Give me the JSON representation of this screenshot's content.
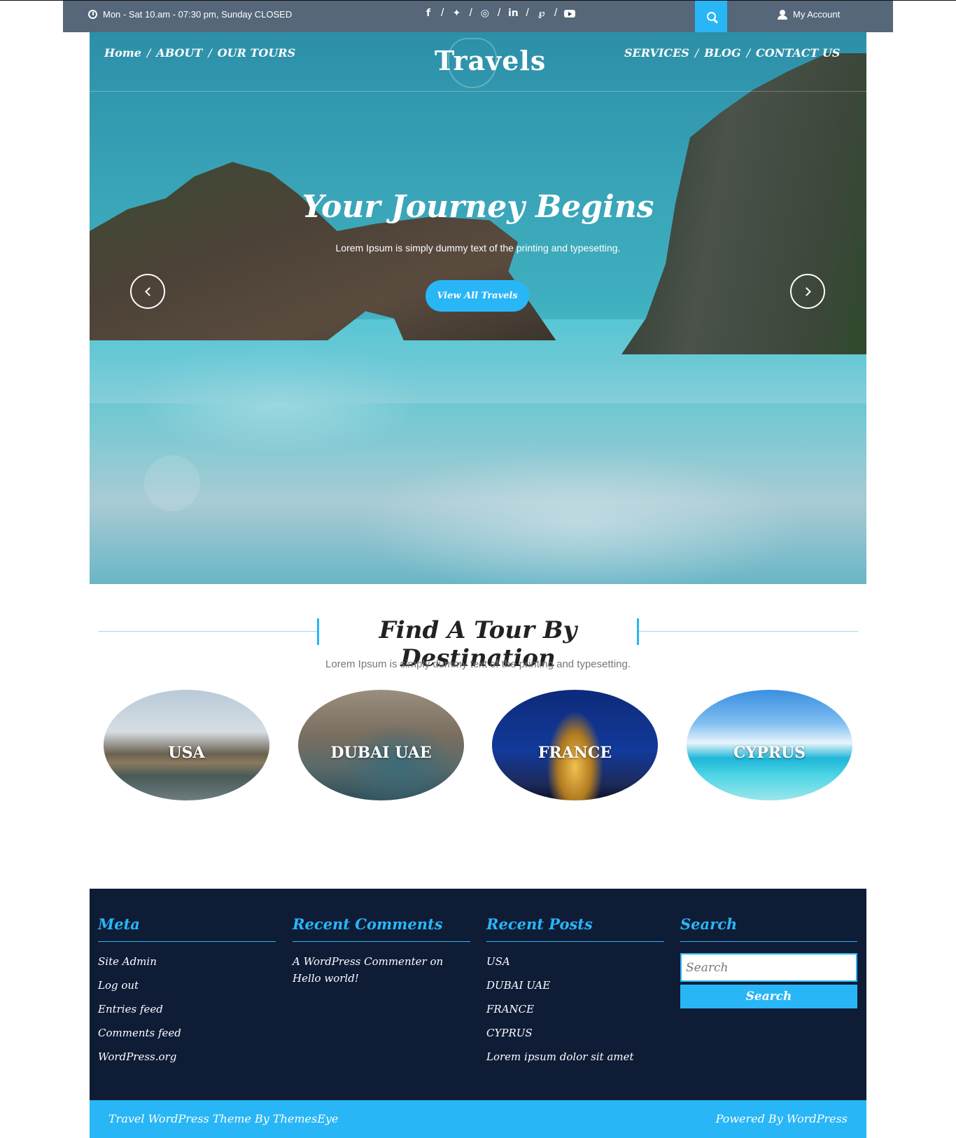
{
  "topbar": {
    "hours": "Mon - Sat 10.am - 07:30 pm, Sunday CLOSED",
    "social_icons": [
      "facebook-icon",
      "twitter-icon",
      "instagram-icon",
      "linkedin-icon",
      "pinterest-icon",
      "youtube-icon"
    ],
    "social_glyphs": {
      "facebook": "f",
      "twitter": "✦",
      "instagram": "◎",
      "linkedin": "in",
      "pinterest": "℘"
    },
    "separator": "/",
    "account_label": "My Account"
  },
  "nav": {
    "left": [
      "Home",
      "ABOUT",
      "OUR TOURS"
    ],
    "right": [
      "SERVICES",
      "BLOG",
      "CONTACT US"
    ],
    "logo": "Travels"
  },
  "hero": {
    "title": "Your Journey Begins",
    "subtitle": "Lorem Ipsum is simply dummy text of the printing and typesetting.",
    "button": "View All Travels"
  },
  "destinations": {
    "title": "Find A Tour By Destination",
    "subtitle": "Lorem Ipsum is simply dummy text of the printing and typesetting.",
    "items": [
      "USA",
      "DUBAI UAE",
      "FRANCE",
      "CYPRUS"
    ]
  },
  "footer": {
    "meta": {
      "title": "Meta",
      "links": [
        "Site Admin",
        "Log out",
        "Entries feed",
        "Comments feed",
        "WordPress.org"
      ]
    },
    "recent_comments": {
      "title": "Recent Comments",
      "items": [
        "A WordPress Commenter on Hello world!"
      ]
    },
    "recent_posts": {
      "title": "Recent Posts",
      "items": [
        "USA",
        "DUBAI UAE",
        "FRANCE",
        "CYPRUS",
        "Lorem ipsum dolor sit amet"
      ]
    },
    "search": {
      "title": "Search",
      "placeholder": "Search",
      "button": "Search"
    }
  },
  "copyright": {
    "left": "Travel WordPress Theme By ThemesEye",
    "right": "Powered By WordPress"
  },
  "colors": {
    "accent": "#29b6f6",
    "footer_bg": "#0e1c36"
  }
}
